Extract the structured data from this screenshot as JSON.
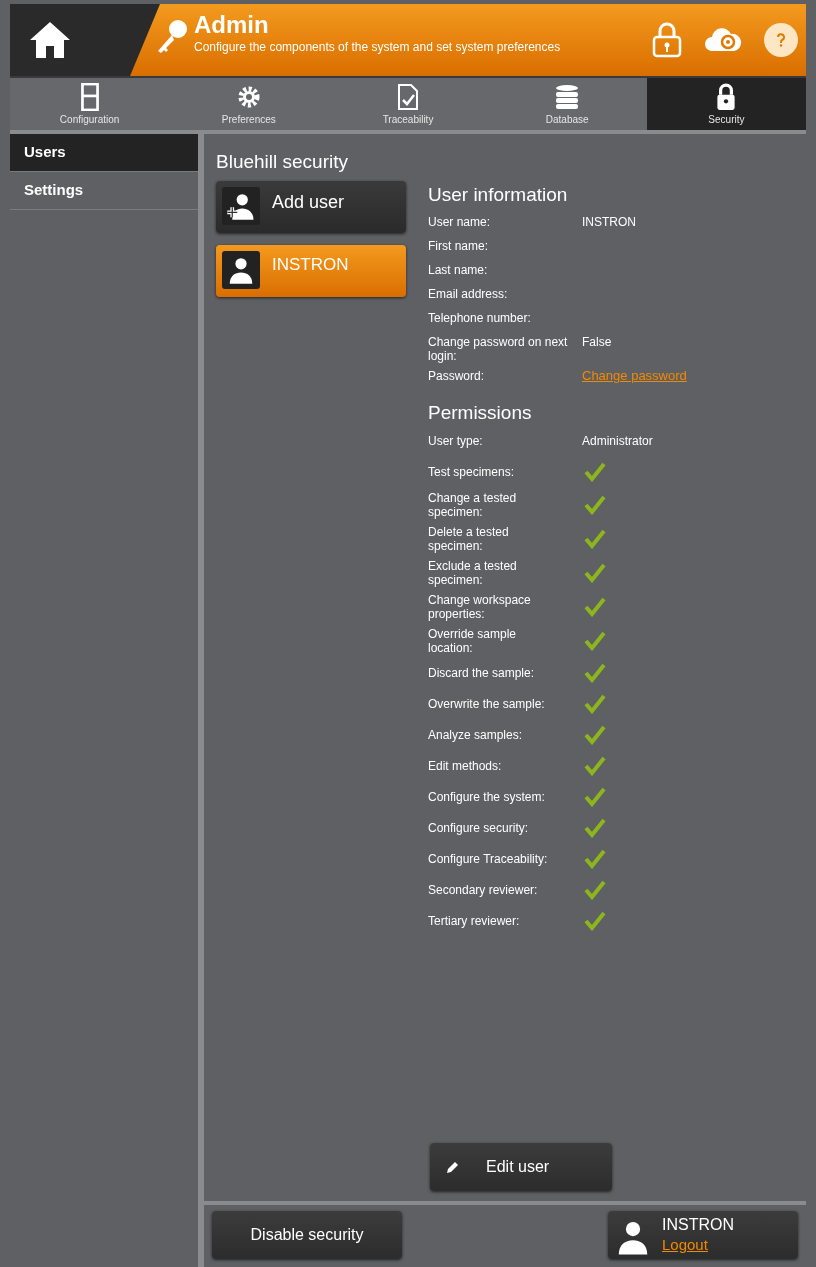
{
  "header": {
    "title": "Admin",
    "subtitle": "Configure the components of the system and set system preferences"
  },
  "tabs": [
    {
      "label": "Configuration",
      "selected": false
    },
    {
      "label": "Preferences",
      "selected": false
    },
    {
      "label": "Traceability",
      "selected": false
    },
    {
      "label": "Database",
      "selected": false
    },
    {
      "label": "Security",
      "selected": true
    }
  ],
  "sidebar": {
    "items": [
      {
        "label": "Users",
        "selected": true
      },
      {
        "label": "Settings",
        "selected": false
      }
    ]
  },
  "main": {
    "title": "Bluehill security",
    "add_user": "Add user",
    "users": [
      {
        "name": "INSTRON",
        "selected": true
      }
    ],
    "user_information": {
      "title": "User information",
      "fields": [
        {
          "label": "User name:",
          "value": "INSTRON"
        },
        {
          "label": "First name:"
        },
        {
          "label": "Last name:"
        },
        {
          "label": "Email address:"
        },
        {
          "label": "Telephone number:"
        },
        {
          "label": "Change password on next login:",
          "value": "False"
        },
        {
          "label": "Password:",
          "link": "Change password"
        }
      ]
    },
    "permissions": {
      "title": "Permissions",
      "user_type": {
        "label": "User type:",
        "value": "Administrator"
      },
      "items": [
        {
          "label": "Test specimens:",
          "checked": true
        },
        {
          "label": "Change a tested specimen:",
          "checked": true
        },
        {
          "label": "Delete a tested specimen:",
          "checked": true
        },
        {
          "label": "Exclude a tested specimen:",
          "checked": true
        },
        {
          "label": "Change workspace properties:",
          "checked": true
        },
        {
          "label": "Override sample location:",
          "checked": true
        },
        {
          "label": "Discard the sample:",
          "checked": true
        },
        {
          "label": "Overwrite the sample:",
          "checked": true
        },
        {
          "label": "Analyze samples:",
          "checked": true
        },
        {
          "label": "Edit methods:",
          "checked": true
        },
        {
          "label": "Configure the system:",
          "checked": true
        },
        {
          "label": "Configure security:",
          "checked": true
        },
        {
          "label": "Configure Traceability:",
          "checked": true
        },
        {
          "label": "Secondary reviewer:",
          "checked": true
        },
        {
          "label": "Tertiary reviewer:",
          "checked": true
        }
      ]
    },
    "edit_user": "Edit user"
  },
  "footer": {
    "disable_security": "Disable security",
    "current_user": "INSTRON",
    "logout": "Logout"
  }
}
